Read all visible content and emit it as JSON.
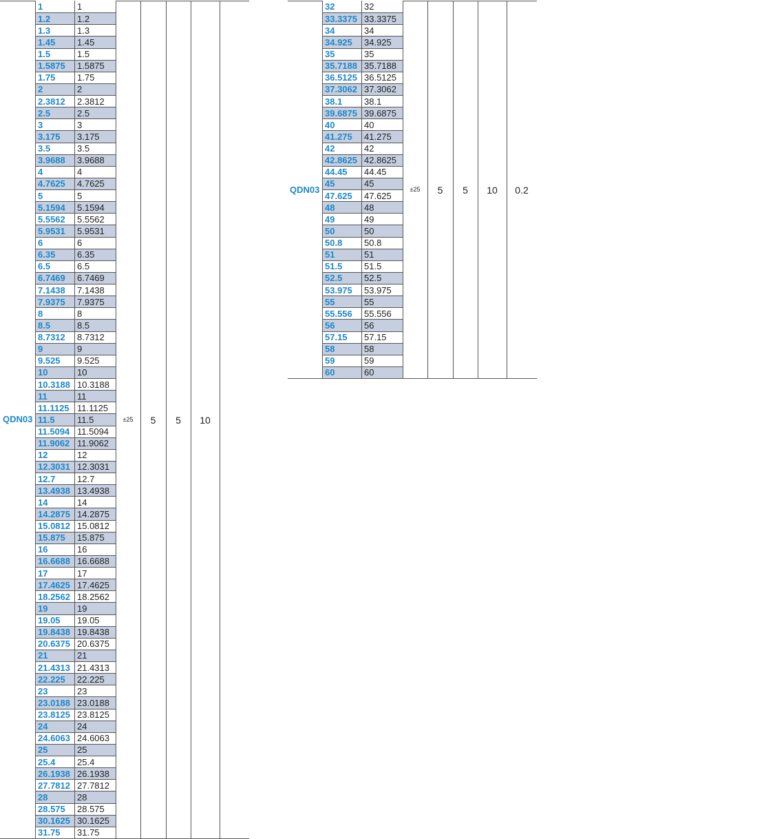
{
  "tables": [
    {
      "model": "QDN03",
      "tolerance": "±25",
      "col3": "5",
      "col4": "5",
      "col5": "10",
      "rows": [
        "1",
        "1.2",
        "1.3",
        "1.45",
        "1.5",
        "1.5875",
        "1.75",
        "2",
        "2.3812",
        "2.5",
        "3",
        "3.175",
        "3.5",
        "3.9688",
        "4",
        "4.7625",
        "5",
        "5.1594",
        "5.5562",
        "5.9531",
        "6",
        "6.35",
        "6.5",
        "6.7469",
        "7.1438",
        "7.9375",
        "8",
        "8.5",
        "8.7312",
        "9",
        "9.525",
        "10",
        "10.3188",
        "11",
        "11.1125",
        "11.5",
        "11.5094",
        "11.9062",
        "12",
        "12.3031",
        "12.7",
        "13.4938",
        "14",
        "14.2875",
        "15.0812",
        "15.875",
        "16",
        "16.6688",
        "17",
        "17.4625",
        "18.2562",
        "19",
        "19.05",
        "19.8438",
        "20.6375",
        "21",
        "21.4313",
        "22.225",
        "23",
        "23.0188",
        "23.8125",
        "24",
        "24.6063",
        "25",
        "25.4",
        "26.1938",
        "27.7812",
        "28",
        "28.575",
        "30.1625",
        "31.75"
      ],
      "shaded": [
        1,
        3,
        5,
        7,
        9,
        11,
        13,
        15,
        17,
        19,
        21,
        23,
        25,
        27,
        29,
        31,
        33,
        35,
        37,
        39,
        41,
        43,
        45,
        47,
        49,
        51,
        53,
        55,
        57,
        59,
        61,
        63,
        65,
        67,
        69
      ]
    },
    {
      "model": "QDN03",
      "tolerance": "±25",
      "col3": "5",
      "col4": "5",
      "col5": "10",
      "col6": "0.2",
      "rows": [
        "32",
        "33.3375",
        "34",
        "34.925",
        "35",
        "35.7188",
        "36.5125",
        "37.3062",
        "38.1",
        "39.6875",
        "40",
        "41.275",
        "42",
        "42.8625",
        "44.45",
        "45",
        "47.625",
        "48",
        "49",
        "50",
        "50.8",
        "51",
        "51.5",
        "52.5",
        "53.975",
        "55",
        "55.556",
        "56",
        "57.15",
        "58",
        "59",
        "60"
      ],
      "shaded": [
        1,
        3,
        5,
        7,
        9,
        11,
        13,
        15,
        17,
        19,
        21,
        23,
        25,
        27,
        29,
        31
      ]
    }
  ]
}
